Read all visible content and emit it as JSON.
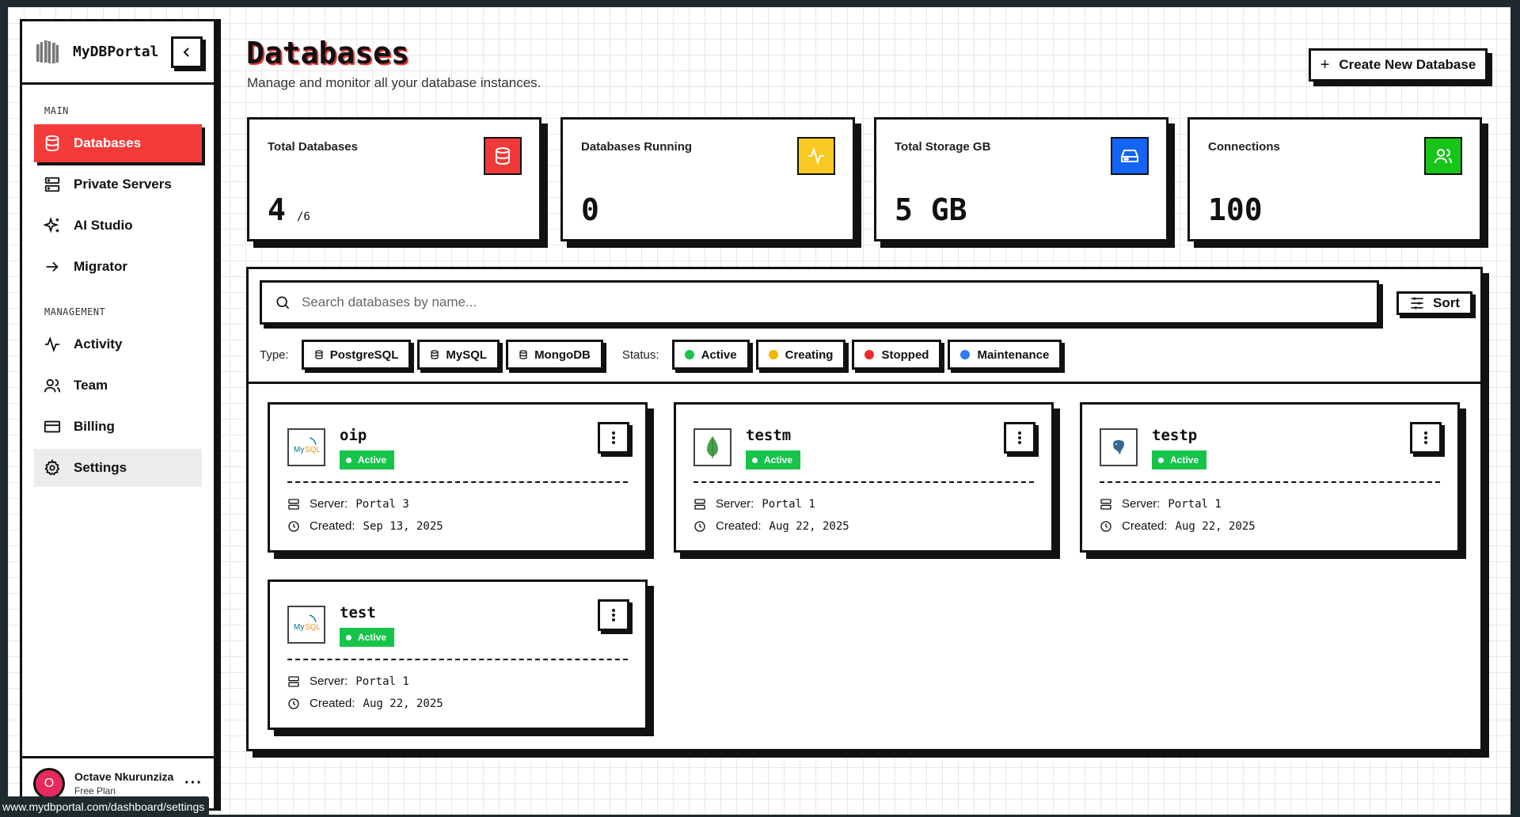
{
  "brand": {
    "name": "MyDBPortal"
  },
  "sidebar": {
    "main_label": "MAIN",
    "main_items": [
      {
        "label": "Databases",
        "icon": "database-icon"
      },
      {
        "label": "Private Servers",
        "icon": "server-icon"
      },
      {
        "label": "AI Studio",
        "icon": "sparkles-icon"
      },
      {
        "label": "Migrator",
        "icon": "arrow-right-icon"
      }
    ],
    "management_label": "MANAGEMENT",
    "management_items": [
      {
        "label": "Activity",
        "icon": "activity-icon"
      },
      {
        "label": "Team",
        "icon": "users-icon"
      },
      {
        "label": "Billing",
        "icon": "credit-card-icon"
      },
      {
        "label": "Settings",
        "icon": "gear-icon"
      }
    ],
    "user": {
      "initial": "O",
      "name": "Octave Nkurunziza",
      "plan": "Free Plan"
    }
  },
  "header": {
    "title": "Databases",
    "subtitle": "Manage and monitor all your database instances.",
    "create_label": "Create New Database"
  },
  "stats": [
    {
      "label": "Total Databases",
      "value": "4",
      "suffix": "/6",
      "color": "#f03a3a",
      "icon": "database-icon"
    },
    {
      "label": "Databases Running",
      "value": "0",
      "suffix": "",
      "color": "#f7c922",
      "icon": "activity-icon"
    },
    {
      "label": "Total Storage GB",
      "value": "5 GB",
      "suffix": "",
      "color": "#1464f5",
      "icon": "hard-drive-icon"
    },
    {
      "label": "Connections",
      "value": "100",
      "suffix": "",
      "color": "#17c417",
      "icon": "users-icon"
    }
  ],
  "search": {
    "placeholder": "Search databases by name..."
  },
  "sort_label": "Sort",
  "filters": {
    "type_label": "Type:",
    "types": [
      "PostgreSQL",
      "MySQL",
      "MongoDB"
    ],
    "status_label": "Status:",
    "statuses": [
      {
        "label": "Active",
        "color": "#16c44a"
      },
      {
        "label": "Creating",
        "color": "#f2b705"
      },
      {
        "label": "Stopped",
        "color": "#ef2b2b"
      },
      {
        "label": "Maintenance",
        "color": "#2f7df0"
      }
    ]
  },
  "databases": [
    {
      "name": "oip",
      "engine": "mysql",
      "status": "Active",
      "server_label": "Server:",
      "server": "Portal 3",
      "created_label": "Created:",
      "created": "Sep 13, 2025"
    },
    {
      "name": "testm",
      "engine": "mongodb",
      "status": "Active",
      "server_label": "Server:",
      "server": "Portal 1",
      "created_label": "Created:",
      "created": "Aug 22, 2025"
    },
    {
      "name": "testp",
      "engine": "postgresql",
      "status": "Active",
      "server_label": "Server:",
      "server": "Portal 1",
      "created_label": "Created:",
      "created": "Aug 22, 2025"
    },
    {
      "name": "test",
      "engine": "mysql",
      "status": "Active",
      "server_label": "Server:",
      "server": "Portal 1",
      "created_label": "Created:",
      "created": "Aug 22, 2025"
    }
  ],
  "status_bar": {
    "url": "www.mydbportal.com/dashboard/settings"
  }
}
